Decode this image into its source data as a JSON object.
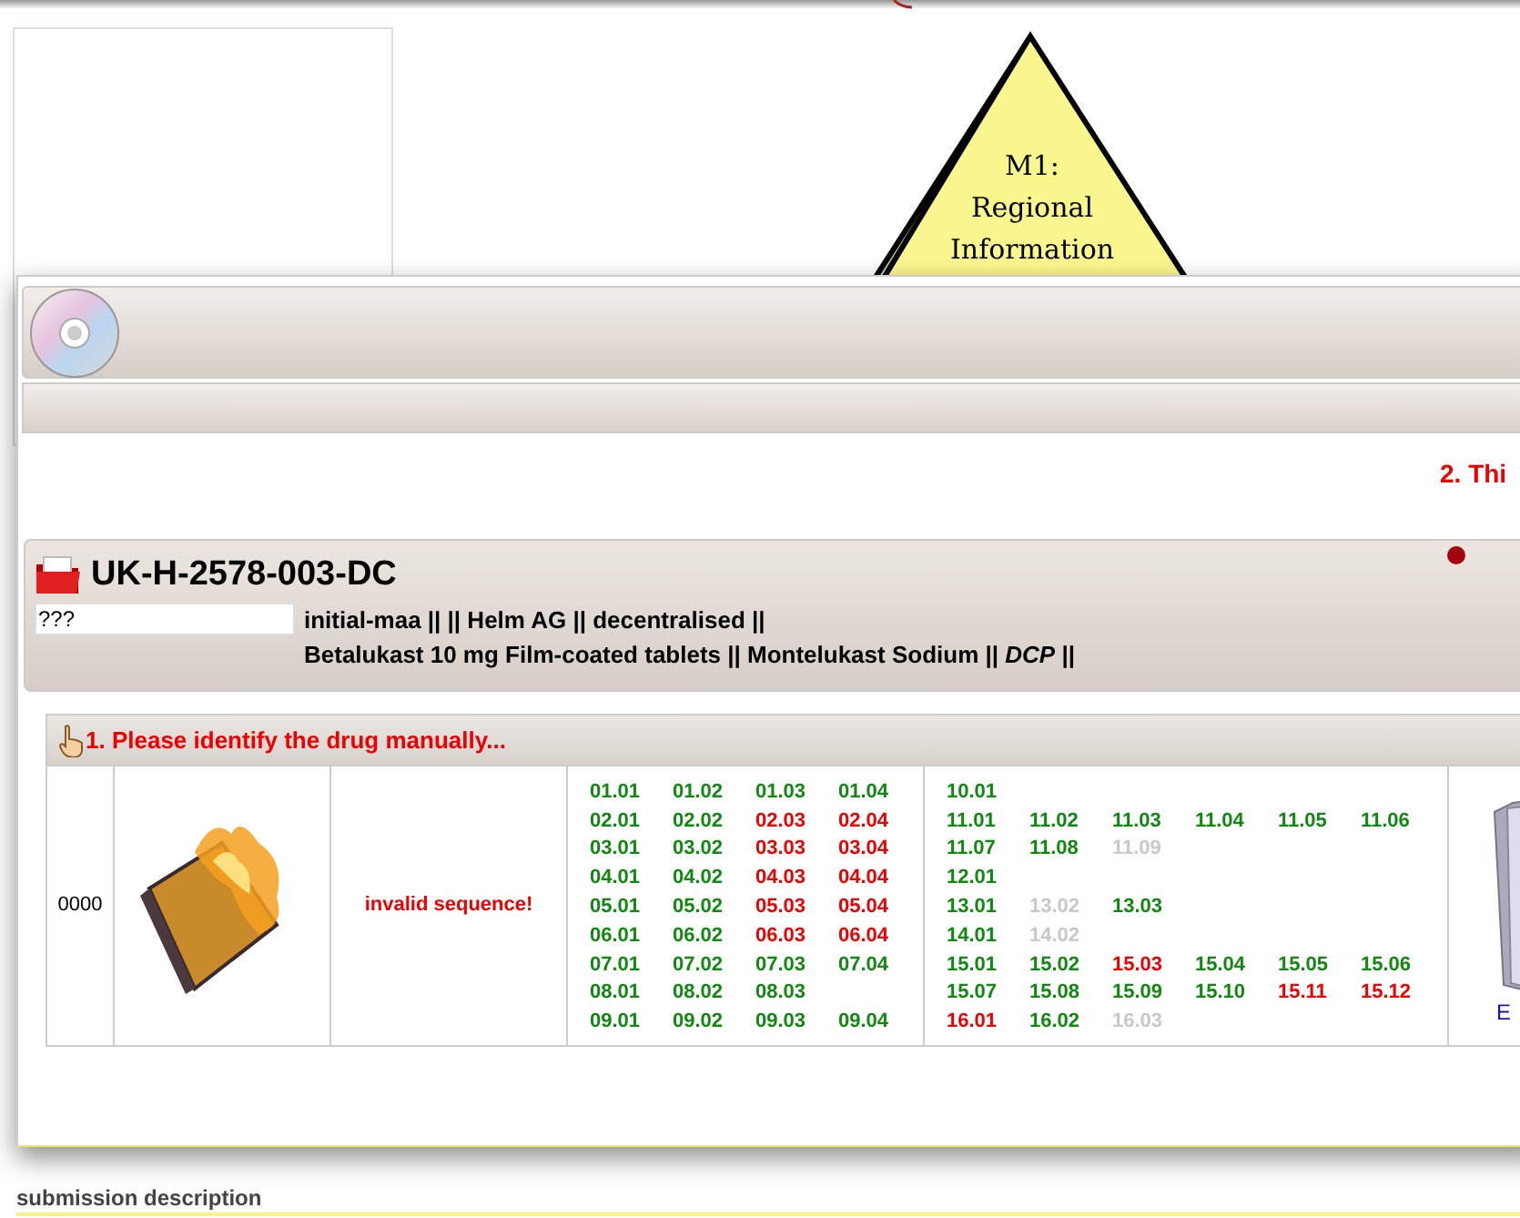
{
  "background": {
    "diagram_text": [
      "M1:",
      "Regional",
      "Information"
    ],
    "section_label": "submission description"
  },
  "dialog": {
    "notice": "2. Thi",
    "procedure": {
      "title": "UK-H-2578-003-DC",
      "field": {
        "value": "???"
      },
      "line_1": "initial-maa || || Helm AG || decentralised ||",
      "line_2": "Betalukast 10 mg Film-coated tablets || Montelukast Sodium || *DCP* ||"
    },
    "identify": {
      "heading": "1. Please identify the drug manually...",
      "row": {
        "number": "0000",
        "message": "invalid sequence!",
        "link": "E",
        "modules_a": [
          [
            {
              "code": "01.01",
              "color": "#118811"
            },
            {
              "code": "01.02",
              "color": "#118811"
            },
            {
              "code": "01.03",
              "color": "#118811"
            },
            {
              "code": "01.04",
              "color": "#118811"
            }
          ],
          [
            {
              "code": "02.01",
              "color": "#118811"
            },
            {
              "code": "02.02",
              "color": "#118811"
            },
            {
              "code": "02.03",
              "color": "#ee0000"
            },
            {
              "code": "02.04",
              "color": "#ee0000"
            }
          ],
          [
            {
              "code": "03.01",
              "color": "#118811"
            },
            {
              "code": "03.02",
              "color": "#118811"
            },
            {
              "code": "03.03",
              "color": "#ee0000"
            },
            {
              "code": "03.04",
              "color": "#ee0000"
            }
          ],
          [
            {
              "code": "04.01",
              "color": "#118811"
            },
            {
              "code": "04.02",
              "color": "#118811"
            },
            {
              "code": "04.03",
              "color": "#ee0000"
            },
            {
              "code": "04.04",
              "color": "#ee0000"
            }
          ],
          [
            {
              "code": "05.01",
              "color": "#118811"
            },
            {
              "code": "05.02",
              "color": "#118811"
            },
            {
              "code": "05.03",
              "color": "#ee0000"
            },
            {
              "code": "05.04",
              "color": "#ee0000"
            }
          ],
          [
            {
              "code": "06.01",
              "color": "#118811"
            },
            {
              "code": "06.02",
              "color": "#118811"
            },
            {
              "code": "06.03",
              "color": "#ee0000"
            },
            {
              "code": "06.04",
              "color": "#ee0000"
            }
          ],
          [
            {
              "code": "07.01",
              "color": "#118811"
            },
            {
              "code": "07.02",
              "color": "#118811"
            },
            {
              "code": "07.03",
              "color": "#118811"
            },
            {
              "code": "07.04",
              "color": "#118811"
            }
          ],
          [
            {
              "code": "08.01",
              "color": "#118811"
            },
            {
              "code": "08.02",
              "color": "#118811"
            },
            {
              "code": "08.03",
              "color": "#118811"
            }
          ],
          [
            {
              "code": "09.01",
              "color": "#118811"
            },
            {
              "code": "09.02",
              "color": "#118811"
            },
            {
              "code": "09.03",
              "color": "#118811"
            },
            {
              "code": "09.04",
              "color": "#118811"
            }
          ]
        ],
        "modules_b": [
          [
            {
              "code": "10.01",
              "color": "#118811"
            }
          ],
          [
            {
              "code": "11.01",
              "color": "#118811"
            },
            {
              "code": "11.02",
              "color": "#118811"
            },
            {
              "code": "11.03",
              "color": "#118811"
            },
            {
              "code": "11.04",
              "color": "#118811"
            },
            {
              "code": "11.05",
              "color": "#118811"
            },
            {
              "code": "11.06",
              "color": "#118811"
            }
          ],
          [
            {
              "code": "11.07",
              "color": "#118811"
            },
            {
              "code": "11.08",
              "color": "#118811"
            },
            {
              "code": "11.09",
              "color": "#c8c8c8"
            }
          ],
          [
            {
              "code": "12.01",
              "color": "#118811"
            }
          ],
          [
            {
              "code": "13.01",
              "color": "#118811"
            },
            {
              "code": "13.02",
              "color": "#c8c8c8"
            },
            {
              "code": "13.03",
              "color": "#118811"
            }
          ],
          [
            {
              "code": "14.01",
              "color": "#118811"
            },
            {
              "code": "14.02",
              "color": "#c8c8c8"
            }
          ],
          [
            {
              "code": "15.01",
              "color": "#118811"
            },
            {
              "code": "15.02",
              "color": "#118811"
            },
            {
              "code": "15.03",
              "color": "#ee0000"
            },
            {
              "code": "15.04",
              "color": "#118811"
            },
            {
              "code": "15.05",
              "color": "#118811"
            },
            {
              "code": "15.06",
              "color": "#118811"
            }
          ],
          [
            {
              "code": "15.07",
              "color": "#118811"
            },
            {
              "code": "15.08",
              "color": "#118811"
            },
            {
              "code": "15.09",
              "color": "#118811"
            },
            {
              "code": "15.10",
              "color": "#118811"
            },
            {
              "code": "15.11",
              "color": "#ee0000"
            },
            {
              "code": "15.12",
              "color": "#ee0000"
            }
          ],
          [
            {
              "code": "16.01",
              "color": "#ee0000"
            },
            {
              "code": "16.02",
              "color": "#118811"
            },
            {
              "code": "16.03",
              "color": "#c8c8c8"
            }
          ]
        ]
      }
    }
  }
}
